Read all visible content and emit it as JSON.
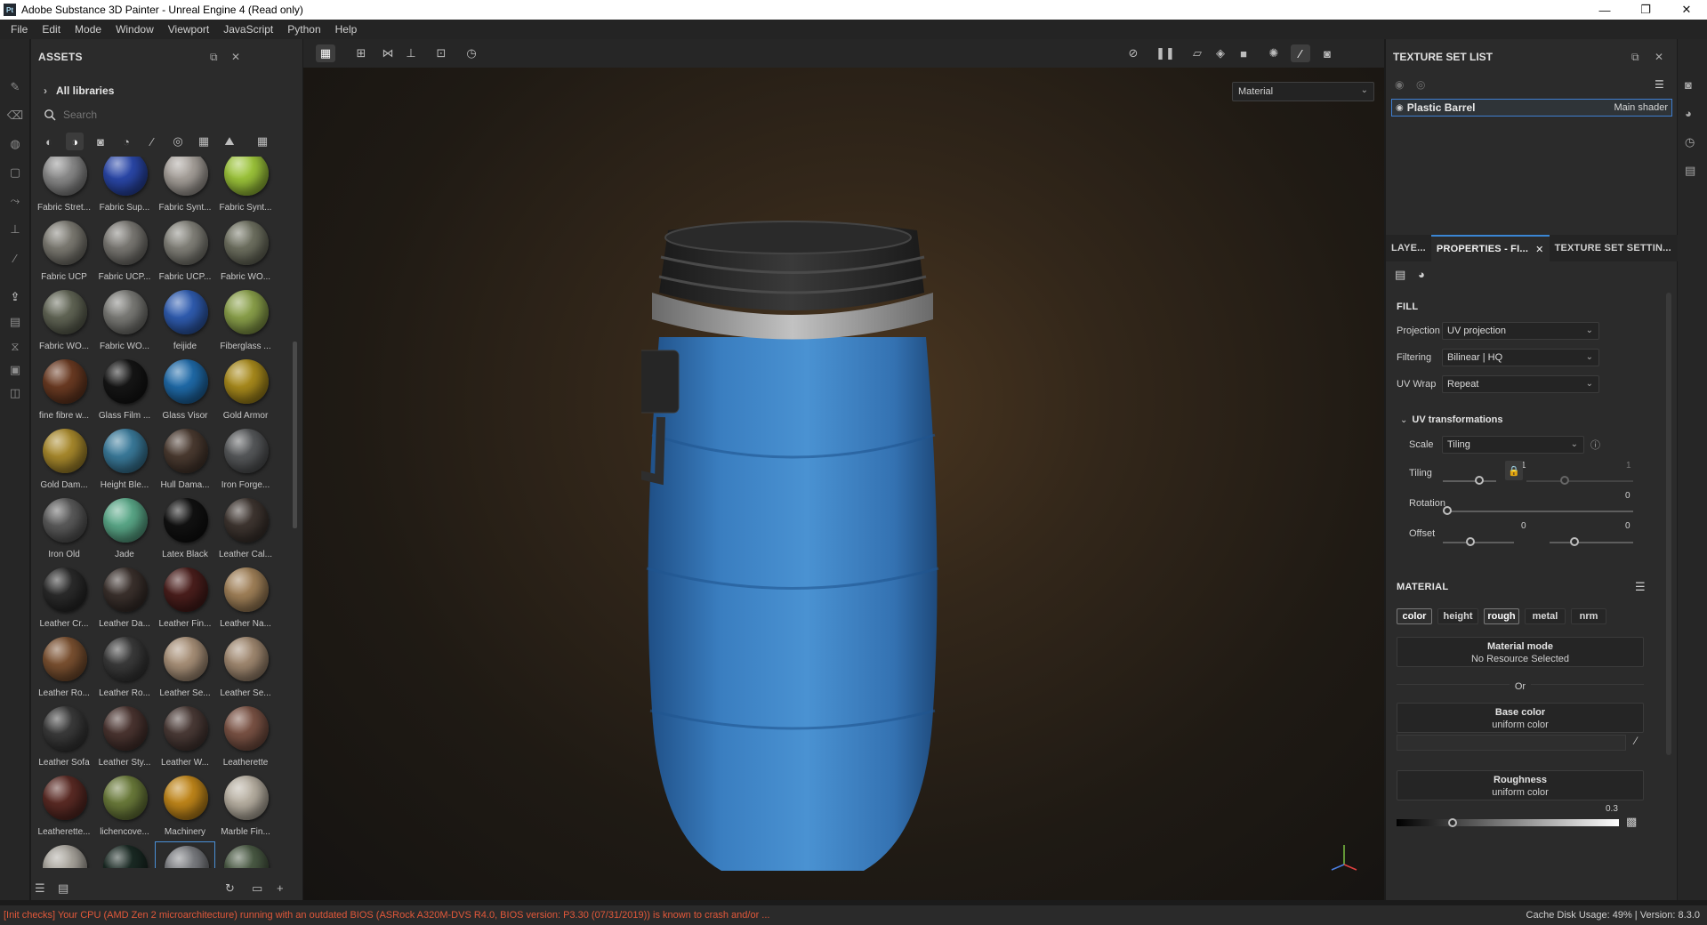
{
  "window": {
    "title": "Adobe Substance 3D Painter - Unreal Engine 4 (Read only)",
    "app_badge": "Pt",
    "minimize_glyph": "—",
    "restore_glyph": "❐",
    "close_glyph": "✕"
  },
  "menu": [
    "File",
    "Edit",
    "Mode",
    "Window",
    "Viewport",
    "JavaScript",
    "Python",
    "Help"
  ],
  "assets": {
    "title": "ASSETS",
    "library": "All libraries",
    "search_placeholder": "Search",
    "items": [
      {
        "label": "Fabric Stret...",
        "color": "#8a8a8a"
      },
      {
        "label": "Fabric Sup...",
        "color": "#2a47a8"
      },
      {
        "label": "Fabric Synt...",
        "color": "#a6a09a"
      },
      {
        "label": "Fabric Synt...",
        "color": "#9cc43a"
      },
      {
        "label": "Fabric UCP",
        "color": "#7c7a72"
      },
      {
        "label": "Fabric UCP...",
        "color": "#7a7873"
      },
      {
        "label": "Fabric UCP...",
        "color": "#828179"
      },
      {
        "label": "Fabric WO...",
        "color": "#6e7060"
      },
      {
        "label": "Fabric WO...",
        "color": "#616555"
      },
      {
        "label": "Fabric WO...",
        "color": "#7a7a76"
      },
      {
        "label": "feijide",
        "color": "#2f5cb0"
      },
      {
        "label": "Fiberglass ...",
        "color": "#8aa04a"
      },
      {
        "label": "fine fibre w...",
        "color": "#6a3a22"
      },
      {
        "label": "Glass Film ...",
        "color": "#151515"
      },
      {
        "label": "Glass Visor",
        "color": "#1f6aa8"
      },
      {
        "label": "Gold Armor",
        "color": "#a88a1c"
      },
      {
        "label": "Gold Dam...",
        "color": "#a8892c"
      },
      {
        "label": "Height Ble...",
        "color": "#3a7a9a"
      },
      {
        "label": "Hull Dama...",
        "color": "#4a3a30"
      },
      {
        "label": "Iron Forge...",
        "color": "#56585a"
      },
      {
        "label": "Iron Old",
        "color": "#5a5a5a"
      },
      {
        "label": "Jade",
        "color": "#5aa888"
      },
      {
        "label": "Latex Black",
        "color": "#111111"
      },
      {
        "label": "Leather Cal...",
        "color": "#3e3530"
      },
      {
        "label": "Leather Cr...",
        "color": "#2a2a2a"
      },
      {
        "label": "Leather Da...",
        "color": "#3a302c"
      },
      {
        "label": "Leather Fin...",
        "color": "#4a1e1c"
      },
      {
        "label": "Leather Na...",
        "color": "#a08058"
      },
      {
        "label": "Leather Ro...",
        "color": "#7a5030"
      },
      {
        "label": "Leather Ro...",
        "color": "#3a3a3a"
      },
      {
        "label": "Leather Se...",
        "color": "#a89078"
      },
      {
        "label": "Leather Se...",
        "color": "#a08870"
      },
      {
        "label": "Leather Sofa",
        "color": "#3a3a3a"
      },
      {
        "label": "Leather Sty...",
        "color": "#4a3430"
      },
      {
        "label": "Leather W...",
        "color": "#4a3a36"
      },
      {
        "label": "Leatherette",
        "color": "#7a5244"
      },
      {
        "label": "Leatherette...",
        "color": "#5a2a24"
      },
      {
        "label": "lichencove...",
        "color": "#6a7a3a"
      },
      {
        "label": "Machinery",
        "color": "#c0861a"
      },
      {
        "label": "Marble Fin...",
        "color": "#b8b0a2"
      },
      {
        "label": "",
        "color": "#a8a49c"
      },
      {
        "label": "",
        "color": "#1a2a24"
      },
      {
        "label": "",
        "color": "#7a7c80"
      },
      {
        "label": "",
        "color": "#4a5a44"
      }
    ]
  },
  "viewport": {
    "material_mode": "Material"
  },
  "texture_set_list": {
    "title": "TEXTURE SET LIST",
    "row_name": "Plastic Barrel",
    "row_shader": "Main shader"
  },
  "tabs": {
    "layers": "LAYE...",
    "properties": "PROPERTIES - FI...",
    "texture_settings": "TEXTURE SET SETTIN..."
  },
  "fill": {
    "title": "FILL",
    "projection_label": "Projection",
    "projection_value": "UV projection",
    "filtering_label": "Filtering",
    "filtering_value": "Bilinear | HQ",
    "uvwrap_label": "UV Wrap",
    "uvwrap_value": "Repeat",
    "uvtrans_title": "UV transformations",
    "scale_label": "Scale",
    "scale_value": "Tiling",
    "tiling_label": "Tiling",
    "tiling_u": "1",
    "tiling_v": "1",
    "rotation_label": "Rotation",
    "rotation_value": "0",
    "offset_label": "Offset",
    "offset_u": "0",
    "offset_v": "0"
  },
  "material": {
    "title": "MATERIAL",
    "channels": [
      "color",
      "height",
      "rough",
      "metal",
      "nrm"
    ],
    "mode_title": "Material mode",
    "mode_value": "No Resource Selected",
    "or_text": "Or",
    "base_color_title": "Base color",
    "base_color_value": "uniform color",
    "roughness_title": "Roughness",
    "roughness_value": "uniform color",
    "roughness_number": "0.3"
  },
  "status": {
    "error": "[Init checks] Your CPU (AMD Zen 2 microarchitecture) running with an outdated BIOS (ASRock A320M-DVS R4.0, BIOS version: P3.30 (07/31/2019)) is known to crash and/or ...",
    "info": "Cache Disk Usage:   49% | Version: 8.3.0"
  }
}
